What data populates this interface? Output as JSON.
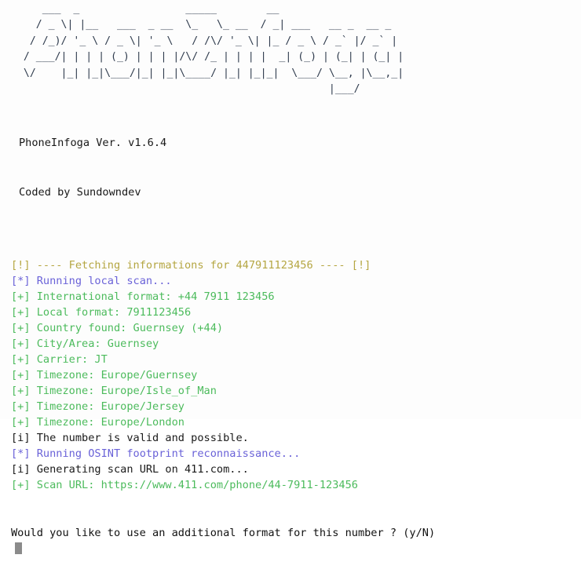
{
  "app": {
    "name": "PhoneInfoga",
    "version_line": "PhoneInfoga Ver. v1.6.4",
    "credit_line": "Coded by Sundowndev",
    "banner_ascii": "     ___  _                 _____        __                  \n    / _ \\| |__   ___  _ __  \\_   \\_ __  / _| ___   __ _  __ _ \n   / /_)/ '_ \\ / _ \\| '_ \\   / /\\/ '_ \\| |_ / _ \\ / _` |/ _` |\n  / ___/| | | | (_) | | | |/\\/ /_ | | | |  _| (_) | (_| | (_| |\n  \\/    |_| |_|\\___/|_| |_|\\____/ |_| |_|_|  \\___/ \\__, |\\__,_|\n                                                   |___/      "
  },
  "colors": {
    "background": "#fdfdfd",
    "warn": "#b5a642",
    "step": "#6a62d8",
    "ok": "#4cbb5c",
    "info": "#1a1a1a",
    "banner": "#2f3b4d",
    "cursor": "#8b8b8b"
  },
  "scan": {
    "target_number": "447911123456",
    "lines": [
      {
        "prefix": "[!]",
        "text": " ---- Fetching informations for 447911123456 ---- [!]",
        "level": "warn"
      },
      {
        "prefix": "[*]",
        "text": " Running local scan...",
        "level": "step"
      },
      {
        "prefix": "[+]",
        "text": " International format: +44 7911 123456",
        "level": "ok"
      },
      {
        "prefix": "[+]",
        "text": " Local format: 7911123456",
        "level": "ok"
      },
      {
        "prefix": "[+]",
        "text": " Country found: Guernsey (+44)",
        "level": "ok"
      },
      {
        "prefix": "[+]",
        "text": " City/Area: Guernsey",
        "level": "ok"
      },
      {
        "prefix": "[+]",
        "text": " Carrier: JT",
        "level": "ok"
      },
      {
        "prefix": "[+]",
        "text": " Timezone: Europe/Guernsey",
        "level": "ok"
      },
      {
        "prefix": "[+]",
        "text": " Timezone: Europe/Isle_of_Man",
        "level": "ok"
      },
      {
        "prefix": "[+]",
        "text": " Timezone: Europe/Jersey",
        "level": "ok"
      },
      {
        "prefix": "[+]",
        "text": " Timezone: Europe/London",
        "level": "ok"
      },
      {
        "prefix": "[i]",
        "text": " The number is valid and possible.",
        "level": "info"
      },
      {
        "prefix": "[*]",
        "text": " Running OSINT footprint reconnaissance...",
        "level": "step"
      },
      {
        "prefix": "[i]",
        "text": " Generating scan URL on 411.com...",
        "level": "info"
      },
      {
        "prefix": "[+]",
        "text": " Scan URL: https://www.411.com/phone/44-7911-123456",
        "level": "ok"
      }
    ]
  },
  "prompt": {
    "question": "Would you like to use an additional format for this number ? (y/N)",
    "input_value": ""
  }
}
